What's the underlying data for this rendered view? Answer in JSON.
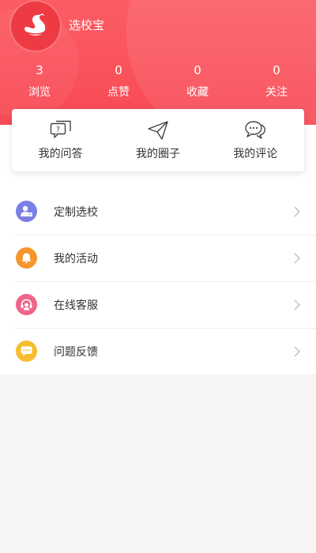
{
  "profile": {
    "app_name": "选校宝",
    "avatar_icon": "swan-logo-icon"
  },
  "stats": [
    {
      "count": "3",
      "label": "浏览"
    },
    {
      "count": "0",
      "label": "点赞"
    },
    {
      "count": "0",
      "label": "收藏"
    },
    {
      "count": "0",
      "label": "关注"
    }
  ],
  "quick_actions": [
    {
      "label": "我的问答",
      "icon": "qa-chat-icon"
    },
    {
      "label": "我的圈子",
      "icon": "paper-plane-icon"
    },
    {
      "label": "我的评论",
      "icon": "comment-bubbles-icon"
    }
  ],
  "menu": [
    {
      "label": "定制选校",
      "icon": "user-card-icon",
      "color": "#7b7fe6"
    },
    {
      "label": "我的活动",
      "icon": "bell-icon",
      "color": "#f5962d"
    },
    {
      "label": "在线客服",
      "icon": "headset-icon",
      "color": "#f0648a"
    },
    {
      "label": "问题反馈",
      "icon": "feedback-chat-icon",
      "color": "#f6be2f"
    }
  ],
  "colors": {
    "brand": "#f84a55",
    "background": "#f5f5f5"
  }
}
